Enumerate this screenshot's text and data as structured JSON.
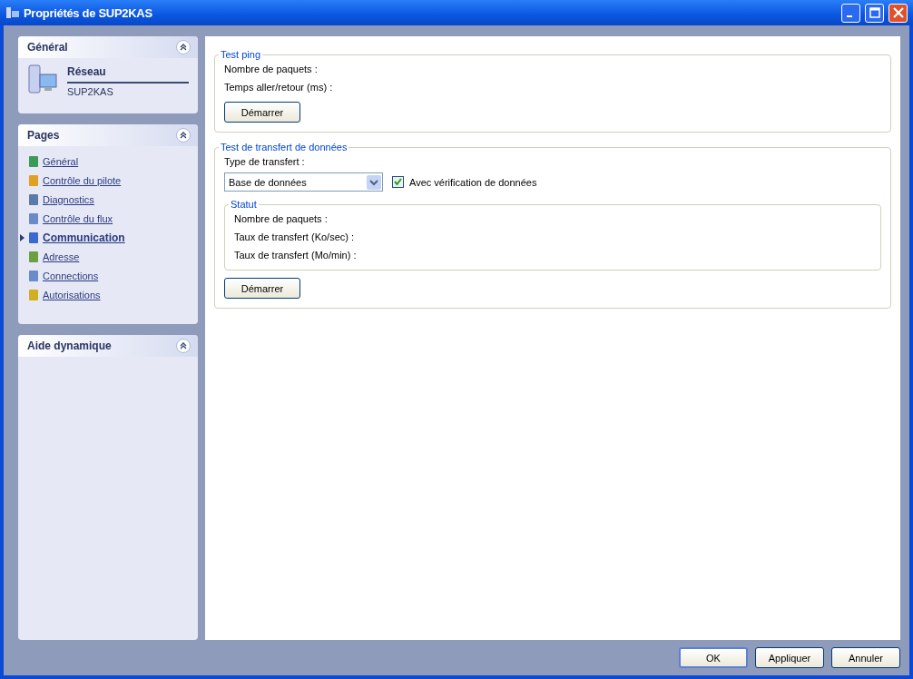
{
  "window": {
    "title": "Propriétés de SUP2KAS"
  },
  "sidebar": {
    "sections": [
      {
        "kind": "info",
        "title": "Général",
        "expanded": true,
        "heading": "Réseau",
        "subtitle": "SUP2KAS"
      },
      {
        "kind": "pages",
        "title": "Pages",
        "expanded": true,
        "items": [
          {
            "label": "Général",
            "selected": false
          },
          {
            "label": "Contrôle du pilote",
            "selected": false
          },
          {
            "label": "Diagnostics",
            "selected": false
          },
          {
            "label": "Contrôle du flux",
            "selected": false
          },
          {
            "label": "Communication",
            "selected": true
          },
          {
            "label": "Adresse",
            "selected": false
          },
          {
            "label": "Connections",
            "selected": false
          },
          {
            "label": "Autorisations",
            "selected": false
          }
        ]
      },
      {
        "kind": "help",
        "title": "Aide dynamique",
        "expanded": true
      }
    ]
  },
  "ping": {
    "title": "Test ping",
    "lines": [
      "Nombre de paquets :",
      "Temps aller/retour (ms) :"
    ],
    "button": "Démarrer"
  },
  "transfer": {
    "title": "Test de transfert de données",
    "type_label": "Type de transfert :",
    "type_value": "Base de données",
    "verify": {
      "label": "Avec vérification de données",
      "checked": true
    },
    "status": {
      "title": "Statut",
      "lines": [
        "Nombre de paquets :",
        "Taux de transfert (Ko/sec) :",
        "Taux de transfert (Mo/min) :"
      ]
    },
    "button": "Démarrer"
  },
  "buttons": [
    "OK",
    "Appliquer",
    "Annuler"
  ]
}
